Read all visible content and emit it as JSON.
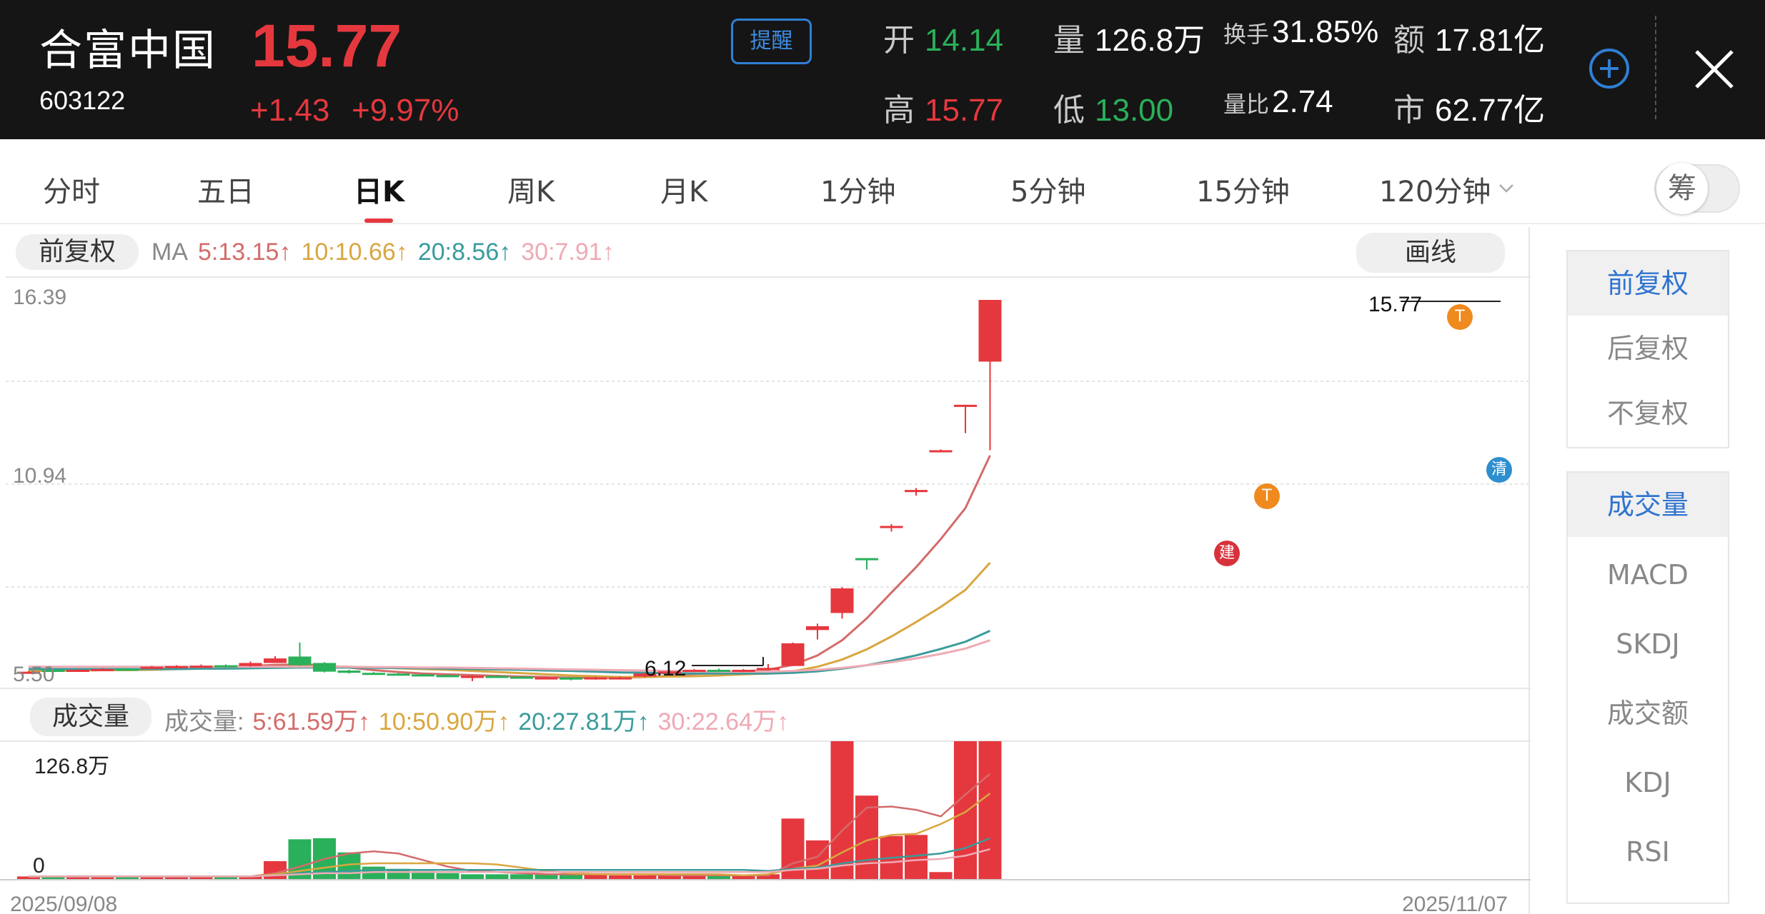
{
  "header": {
    "stock_name": "合富中国",
    "stock_code": "603122",
    "price": "15.77",
    "change": "+1.43",
    "change_pct": "+9.97%",
    "alert_label": "提醒",
    "stats": {
      "open_label": "开",
      "open": "14.14",
      "volume_label": "量",
      "volume": "126.8万",
      "turnover_label": "换手",
      "turnover": "31.85%",
      "amount_label": "额",
      "amount": "17.81亿",
      "high_label": "高",
      "high": "15.77",
      "low_label": "低",
      "low": "13.00",
      "vol_ratio_label": "量比",
      "vol_ratio": "2.74",
      "mktcap_label": "市",
      "mktcap": "62.77亿"
    },
    "colors": {
      "up": "#e5383e",
      "down": "#2ab05a",
      "bg": "#151515"
    }
  },
  "tabs": [
    "分时",
    "五日",
    "日K",
    "周K",
    "月K",
    "1分钟",
    "5分钟",
    "15分钟",
    "120分钟"
  ],
  "active_tab": "日K",
  "chip_toggle_label": "筹",
  "chart_header": {
    "adjust_label": "前复权",
    "ma_prefix": "MA",
    "ma5": "5:13.15↑",
    "ma10": "10:10.66↑",
    "ma20": "20:8.56↑",
    "ma30": "30:7.91↑",
    "draw_button": "画线"
  },
  "volume_header": {
    "label": "成交量",
    "prefix": "成交量:",
    "v5": "5:61.59万↑",
    "v10": "10:50.90万↑",
    "v20": "20:27.81万↑",
    "v30": "30:22.64万↑"
  },
  "axis": {
    "price_top": "16.39",
    "price_mid": "10.94",
    "price_bottom": "5.50",
    "volume_top": "126.8万",
    "volume_zero": "0",
    "date_start": "2025/09/08",
    "date_end": "2025/11/07",
    "high_marker": "15.77",
    "low_marker": "6.12"
  },
  "markers": {
    "build": "建",
    "t": "T",
    "clear": "清"
  },
  "right_panel": {
    "adjust_options": [
      "前复权",
      "后复权",
      "不复权"
    ],
    "indicators": [
      "成交量",
      "MACD",
      "SKDJ",
      "成交额",
      "KDJ",
      "RSI"
    ]
  },
  "chart_data": {
    "type": "candlestick",
    "ylim": [
      5.5,
      16.39
    ],
    "candles": [
      {
        "o": 5.95,
        "c": 5.95,
        "h": 5.97,
        "l": 5.93
      },
      {
        "o": 6.0,
        "c": 5.96,
        "h": 6.02,
        "l": 5.94
      },
      {
        "o": 5.96,
        "c": 6.0,
        "h": 6.03,
        "l": 5.95
      },
      {
        "o": 6.0,
        "c": 6.02,
        "h": 6.05,
        "l": 5.99
      },
      {
        "o": 6.03,
        "c": 6.01,
        "h": 6.05,
        "l": 5.99
      },
      {
        "o": 6.05,
        "c": 6.08,
        "h": 6.1,
        "l": 6.02
      },
      {
        "o": 6.08,
        "c": 6.1,
        "h": 6.12,
        "l": 6.06
      },
      {
        "o": 6.1,
        "c": 6.11,
        "h": 6.14,
        "l": 6.08
      },
      {
        "o": 6.12,
        "c": 6.08,
        "h": 6.14,
        "l": 6.06
      },
      {
        "o": 6.1,
        "c": 6.18,
        "h": 6.22,
        "l": 6.08
      },
      {
        "o": 6.18,
        "c": 6.3,
        "h": 6.36,
        "l": 6.18
      },
      {
        "o": 6.35,
        "c": 6.12,
        "h": 6.72,
        "l": 6.1
      },
      {
        "o": 6.18,
        "c": 5.95,
        "h": 6.2,
        "l": 5.93
      },
      {
        "o": 5.98,
        "c": 5.92,
        "h": 6.0,
        "l": 5.9
      },
      {
        "o": 5.92,
        "c": 5.9,
        "h": 5.94,
        "l": 5.88
      },
      {
        "o": 5.9,
        "c": 5.88,
        "h": 5.92,
        "l": 5.86
      },
      {
        "o": 5.88,
        "c": 5.86,
        "h": 5.9,
        "l": 5.84
      },
      {
        "o": 5.86,
        "c": 5.84,
        "h": 5.88,
        "l": 5.82
      },
      {
        "o": 5.82,
        "c": 5.84,
        "h": 5.86,
        "l": 5.7
      },
      {
        "o": 5.84,
        "c": 5.82,
        "h": 5.86,
        "l": 5.8
      },
      {
        "o": 5.82,
        "c": 5.8,
        "h": 5.84,
        "l": 5.78
      },
      {
        "o": 5.8,
        "c": 5.8,
        "h": 5.82,
        "l": 5.78
      },
      {
        "o": 5.8,
        "c": 5.74,
        "h": 5.8,
        "l": 5.72
      },
      {
        "o": 5.76,
        "c": 5.8,
        "h": 5.82,
        "l": 5.74
      },
      {
        "o": 5.8,
        "c": 5.8,
        "h": 5.82,
        "l": 5.78
      },
      {
        "o": 5.82,
        "c": 5.9,
        "h": 5.92,
        "l": 5.8
      },
      {
        "o": 5.9,
        "c": 5.96,
        "h": 5.98,
        "l": 5.88
      },
      {
        "o": 5.96,
        "c": 6.0,
        "h": 6.02,
        "l": 5.94
      },
      {
        "o": 6.0,
        "c": 5.96,
        "h": 6.03,
        "l": 5.94
      },
      {
        "o": 5.96,
        "c": 6.0,
        "h": 6.02,
        "l": 5.94
      },
      {
        "o": 6.0,
        "c": 6.05,
        "h": 6.15,
        "l": 6.0
      },
      {
        "o": 6.1,
        "c": 6.7,
        "h": 6.72,
        "l": 6.1
      },
      {
        "o": 7.05,
        "c": 7.15,
        "h": 7.22,
        "l": 6.8
      },
      {
        "o": 7.5,
        "c": 8.15,
        "h": 8.18,
        "l": 7.35
      },
      {
        "o": 8.95,
        "c": 8.9,
        "h": 8.95,
        "l": 8.65
      },
      {
        "o": 9.8,
        "c": 9.8,
        "h": 9.85,
        "l": 9.65
      },
      {
        "o": 10.75,
        "c": 10.75,
        "h": 10.8,
        "l": 10.6
      },
      {
        "o": 11.8,
        "c": 11.8,
        "h": 11.82,
        "l": 11.8
      },
      {
        "o": 13.0,
        "c": 13.0,
        "h": 13.0,
        "l": 12.25
      },
      {
        "o": 14.14,
        "c": 15.77,
        "h": 15.77,
        "l": 11.8
      }
    ],
    "ma_series": [
      {
        "name": "MA5",
        "color": "#d46b6b",
        "values": [
          6.0,
          6.0,
          6.0,
          6.0,
          6.0,
          6.01,
          6.04,
          6.06,
          6.08,
          6.1,
          6.13,
          6.14,
          6.12,
          6.06,
          5.99,
          5.94,
          5.9,
          5.88,
          5.86,
          5.84,
          5.82,
          5.81,
          5.79,
          5.79,
          5.79,
          5.81,
          5.84,
          5.89,
          5.92,
          5.96,
          6.0,
          6.13,
          6.38,
          6.78,
          7.36,
          8.04,
          8.71,
          9.45,
          10.27,
          11.66
        ]
      },
      {
        "name": "MA10",
        "color": "#d9a640",
        "values": [
          5.97,
          5.97,
          5.98,
          5.99,
          5.99,
          6.0,
          6.02,
          6.03,
          6.04,
          6.06,
          6.08,
          6.09,
          6.09,
          6.08,
          6.06,
          6.04,
          6.02,
          6.0,
          5.97,
          5.94,
          5.91,
          5.88,
          5.85,
          5.83,
          5.81,
          5.81,
          5.82,
          5.83,
          5.85,
          5.88,
          5.9,
          5.96,
          6.08,
          6.27,
          6.54,
          6.88,
          7.26,
          7.66,
          8.11,
          8.83
        ]
      },
      {
        "name": "MA20",
        "color": "#3a9b9b",
        "values": [
          6.02,
          6.02,
          6.02,
          6.02,
          6.02,
          6.02,
          6.02,
          6.03,
          6.03,
          6.04,
          6.05,
          6.06,
          6.06,
          6.06,
          6.05,
          6.05,
          6.04,
          6.03,
          6.02,
          6.01,
          6.0,
          5.98,
          5.97,
          5.95,
          5.93,
          5.92,
          5.91,
          5.9,
          5.9,
          5.9,
          5.9,
          5.92,
          5.96,
          6.03,
          6.12,
          6.24,
          6.38,
          6.55,
          6.74,
          7.03
        ]
      },
      {
        "name": "MA30",
        "color": "#eeaab4",
        "values": [
          6.08,
          6.08,
          6.08,
          6.08,
          6.08,
          6.08,
          6.08,
          6.08,
          6.08,
          6.08,
          6.08,
          6.08,
          6.08,
          6.08,
          6.07,
          6.07,
          6.06,
          6.06,
          6.05,
          6.04,
          6.03,
          6.02,
          6.01,
          6.0,
          5.99,
          5.98,
          5.97,
          5.96,
          5.95,
          5.95,
          5.95,
          5.97,
          6.0,
          6.05,
          6.12,
          6.2,
          6.3,
          6.42,
          6.56,
          6.78
        ]
      }
    ],
    "volume": {
      "ylim": [
        0,
        126.8
      ],
      "values": [
        3,
        3,
        4,
        4,
        3,
        3,
        3,
        3,
        3,
        3,
        17,
        37,
        38,
        25,
        12,
        10,
        8,
        6,
        5,
        5,
        5,
        5,
        5,
        5,
        4,
        4,
        4,
        5,
        5,
        4,
        5,
        56,
        36,
        126.8,
        77,
        40,
        41,
        7,
        126.8,
        126.8
      ],
      "up": [
        true,
        false,
        true,
        true,
        false,
        true,
        true,
        true,
        false,
        true,
        true,
        false,
        false,
        false,
        false,
        false,
        false,
        false,
        false,
        false,
        false,
        false,
        false,
        true,
        true,
        true,
        true,
        true,
        false,
        true,
        true,
        true,
        true,
        true,
        true,
        true,
        true,
        true,
        true,
        true
      ],
      "ma_series": [
        {
          "name": "MA5",
          "color": "#d46b6b",
          "values": [
            3,
            3,
            3,
            3,
            3,
            3,
            3,
            3,
            3,
            3,
            6,
            12,
            19,
            24,
            26,
            24,
            18,
            12,
            8,
            7,
            6,
            5,
            5,
            5,
            5,
            5,
            4,
            4,
            4,
            4,
            4,
            15,
            21,
            45,
            66,
            67,
            64,
            58,
            78,
            97
          ]
        },
        {
          "name": "MA10",
          "color": "#d9a640",
          "values": [
            3,
            3,
            3,
            3,
            3,
            3,
            3,
            3,
            3,
            3,
            5,
            8,
            11,
            14,
            15,
            15,
            15,
            15,
            15,
            14,
            11,
            8,
            6,
            5,
            5,
            5,
            5,
            5,
            5,
            4,
            5,
            10,
            13,
            25,
            36,
            41,
            42,
            51,
            62,
            79
          ]
        },
        {
          "name": "MA20",
          "color": "#3a9b9b",
          "values": [
            3,
            3,
            3,
            3,
            3,
            3,
            3,
            3,
            3,
            3,
            4,
            6,
            7,
            8,
            9,
            9,
            9,
            9,
            9,
            9,
            9,
            9,
            9,
            9,
            9,
            9,
            9,
            9,
            9,
            9,
            8,
            10,
            11,
            15,
            18,
            20,
            22,
            24,
            29,
            38
          ]
        },
        {
          "name": "MA30",
          "color": "#eeaab4",
          "values": [
            3,
            3,
            3,
            3,
            3,
            3,
            3,
            3,
            3,
            3,
            4,
            5,
            6,
            6,
            7,
            7,
            7,
            7,
            7,
            7,
            7,
            7,
            7,
            7,
            7,
            7,
            7,
            7,
            7,
            7,
            7,
            9,
            10,
            13,
            15,
            16,
            18,
            19,
            22,
            28
          ]
        }
      ]
    },
    "events": [
      {
        "index": 31,
        "label": "建",
        "price": 9.5
      },
      {
        "index": 33,
        "label": "T",
        "price": 11.0
      },
      {
        "index": 38,
        "label": "T",
        "price": 15.88
      },
      {
        "index": 39,
        "label": "清",
        "price": 10.8
      }
    ]
  }
}
